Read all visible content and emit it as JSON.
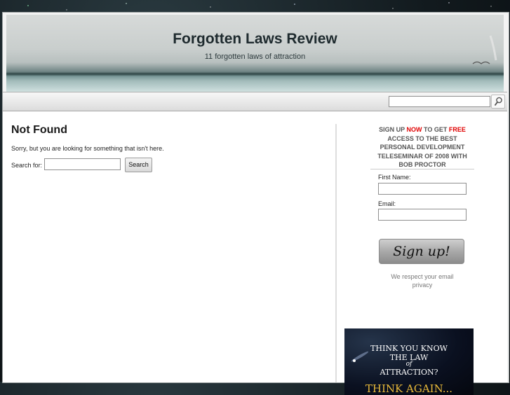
{
  "site": {
    "title": "Forgotten Laws Review",
    "tagline": "11 forgotten laws of attraction"
  },
  "nav": {
    "search_value": "",
    "search_button_icon": "magnifier-icon"
  },
  "main": {
    "heading": "Not Found",
    "message": "Sorry, but you are looking for something that isn't here.",
    "search_label": "Search for:",
    "search_value": "",
    "search_button": "Search"
  },
  "sidebar": {
    "promo": {
      "part1": "SIGN UP ",
      "now": "NOW",
      "part2": " TO GET ",
      "free": "FREE",
      "part3": " ACCESS TO THE BEST PERSONAL DEVELOPMENT TELESEMINAR OF 2008 WITH BOB PROCTOR"
    },
    "first_name_label": "First Name:",
    "email_label": "Email:",
    "signup_button": "Sign up!",
    "respect_text": "We respect your email",
    "privacy_link": "privacy",
    "banner": {
      "line1": "THINK YOU KNOW",
      "line2": "THE LAW",
      "line3": "of",
      "line4": "ATTRACTION?",
      "line5": "THINK AGAIN..."
    }
  },
  "colors": {
    "accent_red": "#e00000",
    "banner_gold": "#e8b93a"
  }
}
